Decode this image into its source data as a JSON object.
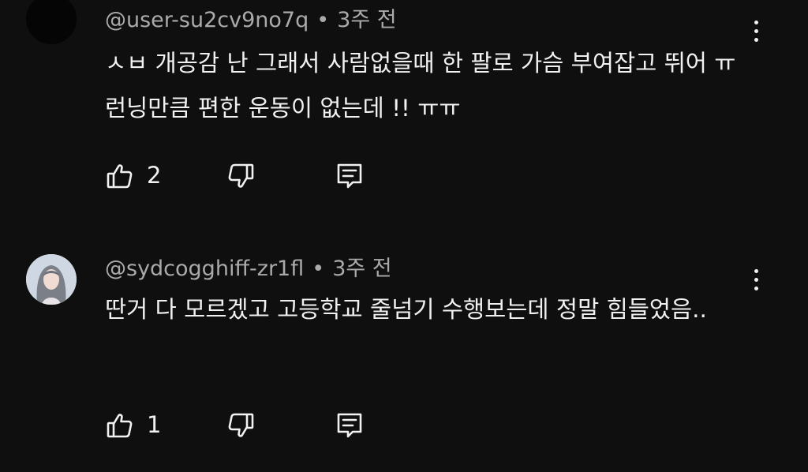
{
  "comments": [
    {
      "author": "@user-su2cv9no7q",
      "separator": "•",
      "time": "3주 전",
      "text": "ㅅㅂ 개공감 난 그래서 사람없을때 한 팔로 가슴 부여잡고 뛰어 ㅠ 런닝만큼 편한 운동이 없는데 !! ㅠㅠ",
      "likes": "2",
      "avatar_icon": "avatar-dark",
      "more_icon": "more-vertical-icon"
    },
    {
      "author": "@sydcogghiff-zr1fl",
      "separator": "•",
      "time": "3주 전",
      "text": "딴거 다 모르겠고 고등학교 줄넘기 수행보는데 정말 힘들었음..",
      "likes": "1",
      "avatar_icon": "avatar-woman",
      "more_icon": "more-vertical-icon"
    }
  ],
  "actions": {
    "like_icon": "thumbs-up-icon",
    "dislike_icon": "thumbs-down-icon",
    "reply_icon": "reply-comment-icon"
  },
  "colors": {
    "background": "#0f0f0f",
    "primary_text": "#f1f1f1",
    "secondary_text": "#aaaaaa"
  }
}
